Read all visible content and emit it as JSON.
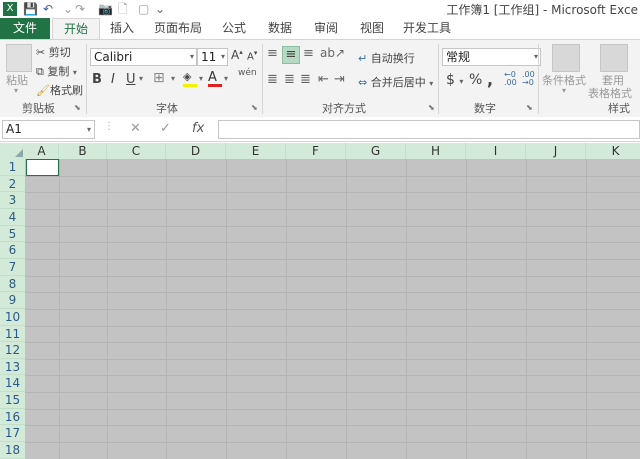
{
  "qat": {
    "save": "💾",
    "undo": "↶",
    "redo": "↷",
    "camera": "📷",
    "new": "🗋",
    "more": "⌄"
  },
  "title": "工作簿1  [工作组] - Microsoft Exce",
  "tabs": [
    "文件",
    "开始",
    "插入",
    "页面布局",
    "公式",
    "数据",
    "审阅",
    "视图",
    "开发工具"
  ],
  "clipboard": {
    "paste": "粘贴",
    "cut": "剪切",
    "copy": "复制",
    "format_painter": "格式刷",
    "label": "剪贴板"
  },
  "font": {
    "name": "Calibri",
    "size": "11",
    "grow": "A",
    "shrink": "A",
    "bold": "B",
    "italic": "I",
    "underline": "U",
    "label": "字体",
    "wen": "wén"
  },
  "alignment": {
    "wrap": "自动换行",
    "merge": "合并后居中",
    "label": "对齐方式"
  },
  "number": {
    "format": "常规",
    "currency": "$",
    "percent": "%",
    "comma": ",",
    "label": "数字"
  },
  "styles": {
    "conditional": "条件格式",
    "table": "套用",
    "table2": "表格格式",
    "label": "样式"
  },
  "formula_bar": {
    "namebox": "A1",
    "cancel": "✕",
    "enter": "✓",
    "fx": "fx"
  },
  "columns": [
    "A",
    "B",
    "C",
    "D",
    "E",
    "F",
    "G",
    "H",
    "I",
    "J",
    "K"
  ],
  "rows": [
    "1",
    "2",
    "3",
    "4",
    "5",
    "6",
    "7",
    "8",
    "9",
    "10",
    "11",
    "12",
    "13",
    "14",
    "15",
    "16",
    "17",
    "18"
  ],
  "colors": {
    "accent": "#217346",
    "header_bg": "#d3ead9",
    "grid_bg": "#c3c3c3"
  }
}
